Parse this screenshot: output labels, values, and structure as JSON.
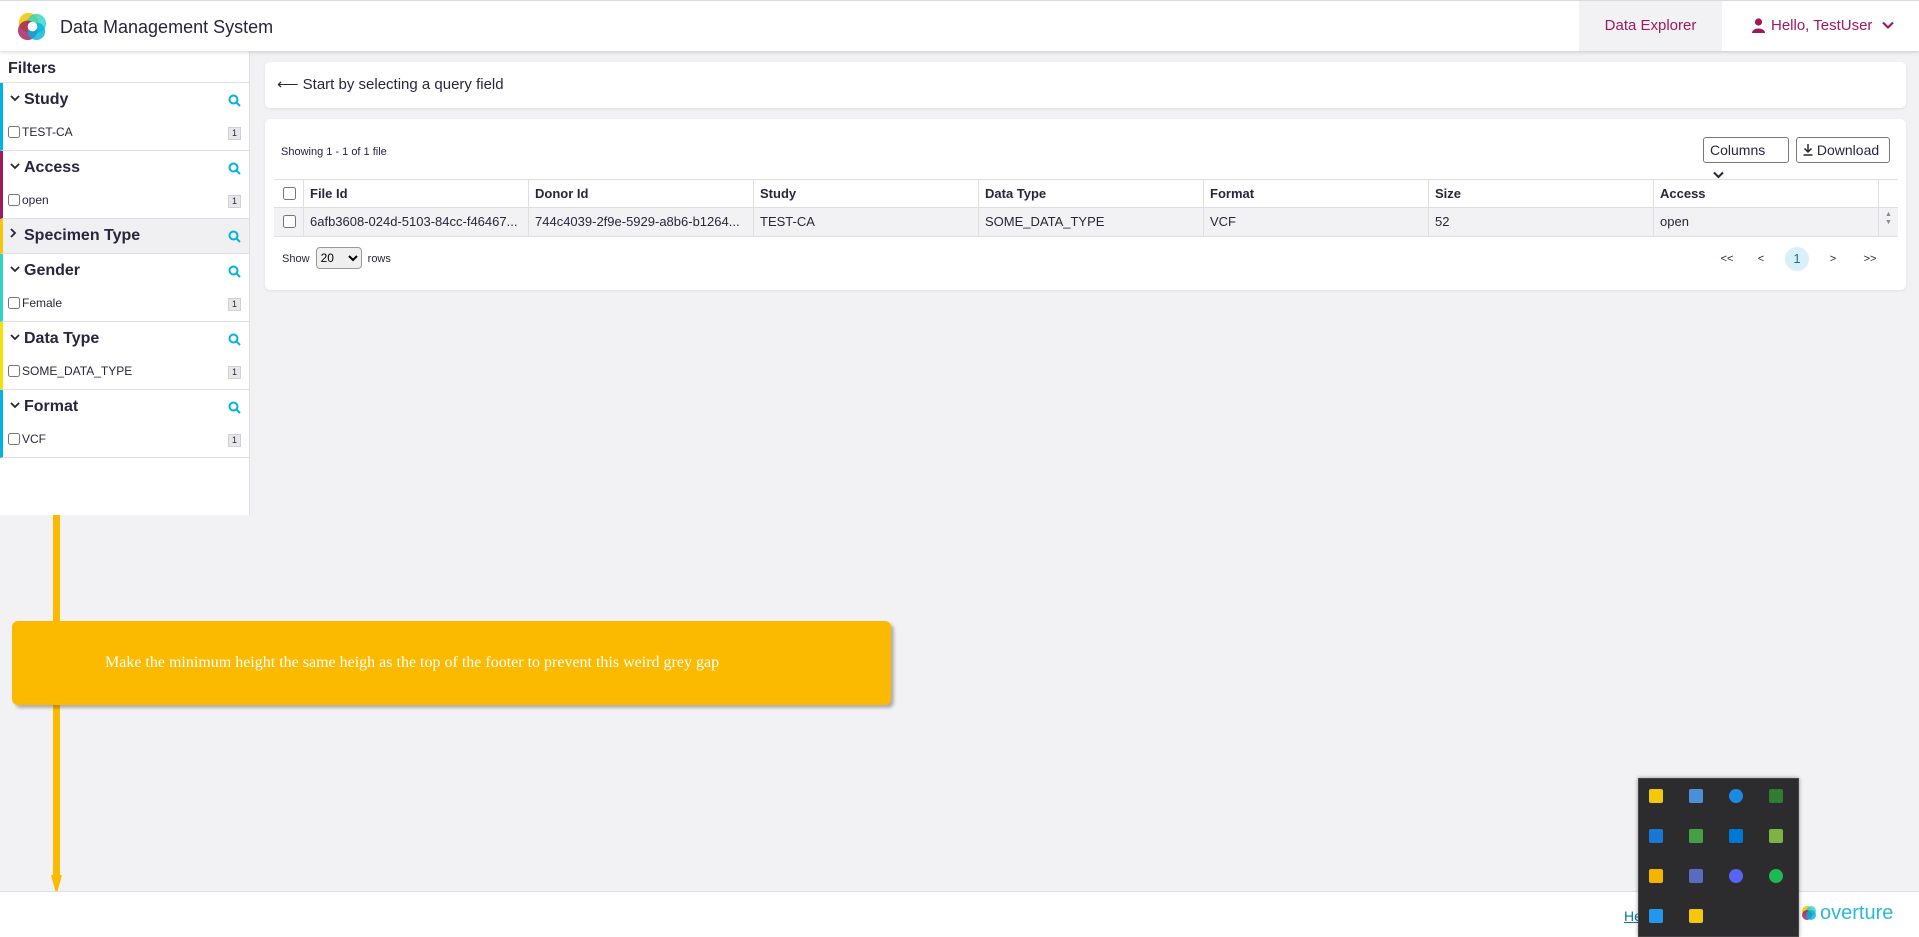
{
  "header": {
    "app_title": "Data Management System",
    "nav_explorer": "Data Explorer",
    "nav_user": "Hello, TestUser"
  },
  "sidebar": {
    "title": "Filters",
    "facets": [
      {
        "name": "Study",
        "expanded": true,
        "color": "#00b3e0",
        "items": [
          {
            "label": "TEST-CA",
            "count": "1"
          }
        ]
      },
      {
        "name": "Access",
        "expanded": true,
        "color": "#a2185e",
        "items": [
          {
            "label": "open",
            "count": "1"
          }
        ]
      },
      {
        "name": "Specimen Type",
        "expanded": false,
        "color": "#f3c80a",
        "items": []
      },
      {
        "name": "Gender",
        "expanded": true,
        "color": "#2fd5c0",
        "items": [
          {
            "label": "Female",
            "count": "1"
          }
        ]
      },
      {
        "name": "Data Type",
        "expanded": true,
        "color": "#f3e20a",
        "items": [
          {
            "label": "SOME_DATA_TYPE",
            "count": "1"
          }
        ]
      },
      {
        "name": "Format",
        "expanded": true,
        "color": "#00b3e0",
        "items": [
          {
            "label": "VCF",
            "count": "1"
          }
        ]
      }
    ]
  },
  "query": {
    "prompt": "⟵ Start by selecting a query field"
  },
  "table": {
    "showing": "Showing 1 - 1 of 1 file",
    "columns_label": "Columns",
    "download_label": "Download",
    "headers": [
      "File Id",
      "Donor Id",
      "Study",
      "Data Type",
      "Format",
      "Size",
      "Access"
    ],
    "rows": [
      [
        "6afb3608-024d-5103-84cc-f46467...",
        "744c4039-2f9e-5929-a8b6-b1264...",
        "TEST-CA",
        "SOME_DATA_TYPE",
        "VCF",
        "52",
        "open"
      ]
    ],
    "show_label": "Show",
    "rows_label": "rows",
    "page_size": "20",
    "pager": {
      "first": "<<",
      "prev": "<",
      "current": "1",
      "next": ">",
      "last": ">>"
    }
  },
  "annotation": {
    "text": "Make the minimum height the same heigh as the top of the footer to prevent this weird grey gap",
    "color": "#fbba00"
  },
  "footer": {
    "help": "He",
    "brand": "overture"
  },
  "tray": {
    "icons": [
      "shield-key-icon",
      "monitor-icon",
      "bluetooth-icon",
      "security-shield-icon",
      "w-app-icon",
      "lock-globe-icon",
      "outlook-icon",
      "laptop-cloud-icon",
      "mail-icon",
      "network-icon",
      "discord-icon",
      "spotify-icon",
      "docker-icon",
      "sticky-note-icon"
    ]
  },
  "colors": {
    "accent": "#a2185e",
    "info": "#00b3e0"
  }
}
